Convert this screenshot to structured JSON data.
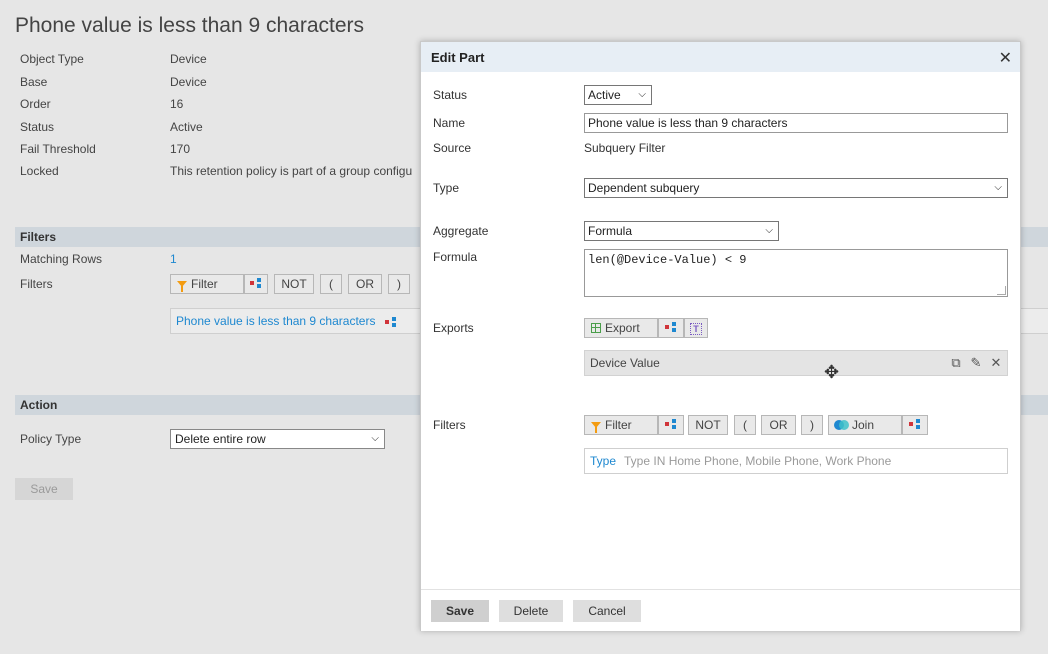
{
  "background": {
    "title": "Phone value is less than 9 characters",
    "properties": [
      {
        "label": "Object Type",
        "value": "Device"
      },
      {
        "label": "Base",
        "value": "Device"
      },
      {
        "label": "Order",
        "value": "16"
      },
      {
        "label": "Status",
        "value": "Active"
      },
      {
        "label": "Fail Threshold",
        "value": "170"
      },
      {
        "label": "Locked",
        "value": "This retention policy is part of a group configu"
      }
    ],
    "filters_section": {
      "title": "Filters",
      "matching_rows_label": "Matching Rows",
      "matching_rows_value": "1",
      "filters_label": "Filters",
      "filter_button": "Filter",
      "not_button": "NOT",
      "open_paren": "(",
      "or_button": "OR",
      "close_paren": ")",
      "filter_item": "Phone value is less than 9 characters"
    },
    "action_section": {
      "title": "Action",
      "policy_type_label": "Policy Type",
      "policy_type_value": "Delete entire row"
    },
    "save_label": "Save"
  },
  "dialog": {
    "title": "Edit Part",
    "close_icon": "close-icon",
    "status_label": "Status",
    "status_value": "Active",
    "name_label": "Name",
    "name_value": "Phone value is less than 9 characters",
    "source_label": "Source",
    "source_value": "Subquery Filter",
    "type_label": "Type",
    "type_value": "Dependent subquery",
    "aggregate_label": "Aggregate",
    "aggregate_value": "Formula",
    "formula_label": "Formula",
    "formula_value": "len(@Device-Value) < 9",
    "exports_label": "Exports",
    "export_button": "Export",
    "export_item": "Device Value",
    "filters_label": "Filters",
    "filter_button": "Filter",
    "not_button": "NOT",
    "open_paren": "(",
    "or_button": "OR",
    "close_paren": ")",
    "join_button": "Join",
    "rule_field": "Type",
    "rule_text": "Type IN Home Phone, Mobile Phone, Work Phone",
    "footer": {
      "save": "Save",
      "delete": "Delete",
      "cancel": "Cancel"
    }
  },
  "colors": {
    "accent": "#1e88d0",
    "header_bg": "#e7eef5",
    "section_bar": "#cfd6dc",
    "filter_orange": "#f39c12"
  }
}
